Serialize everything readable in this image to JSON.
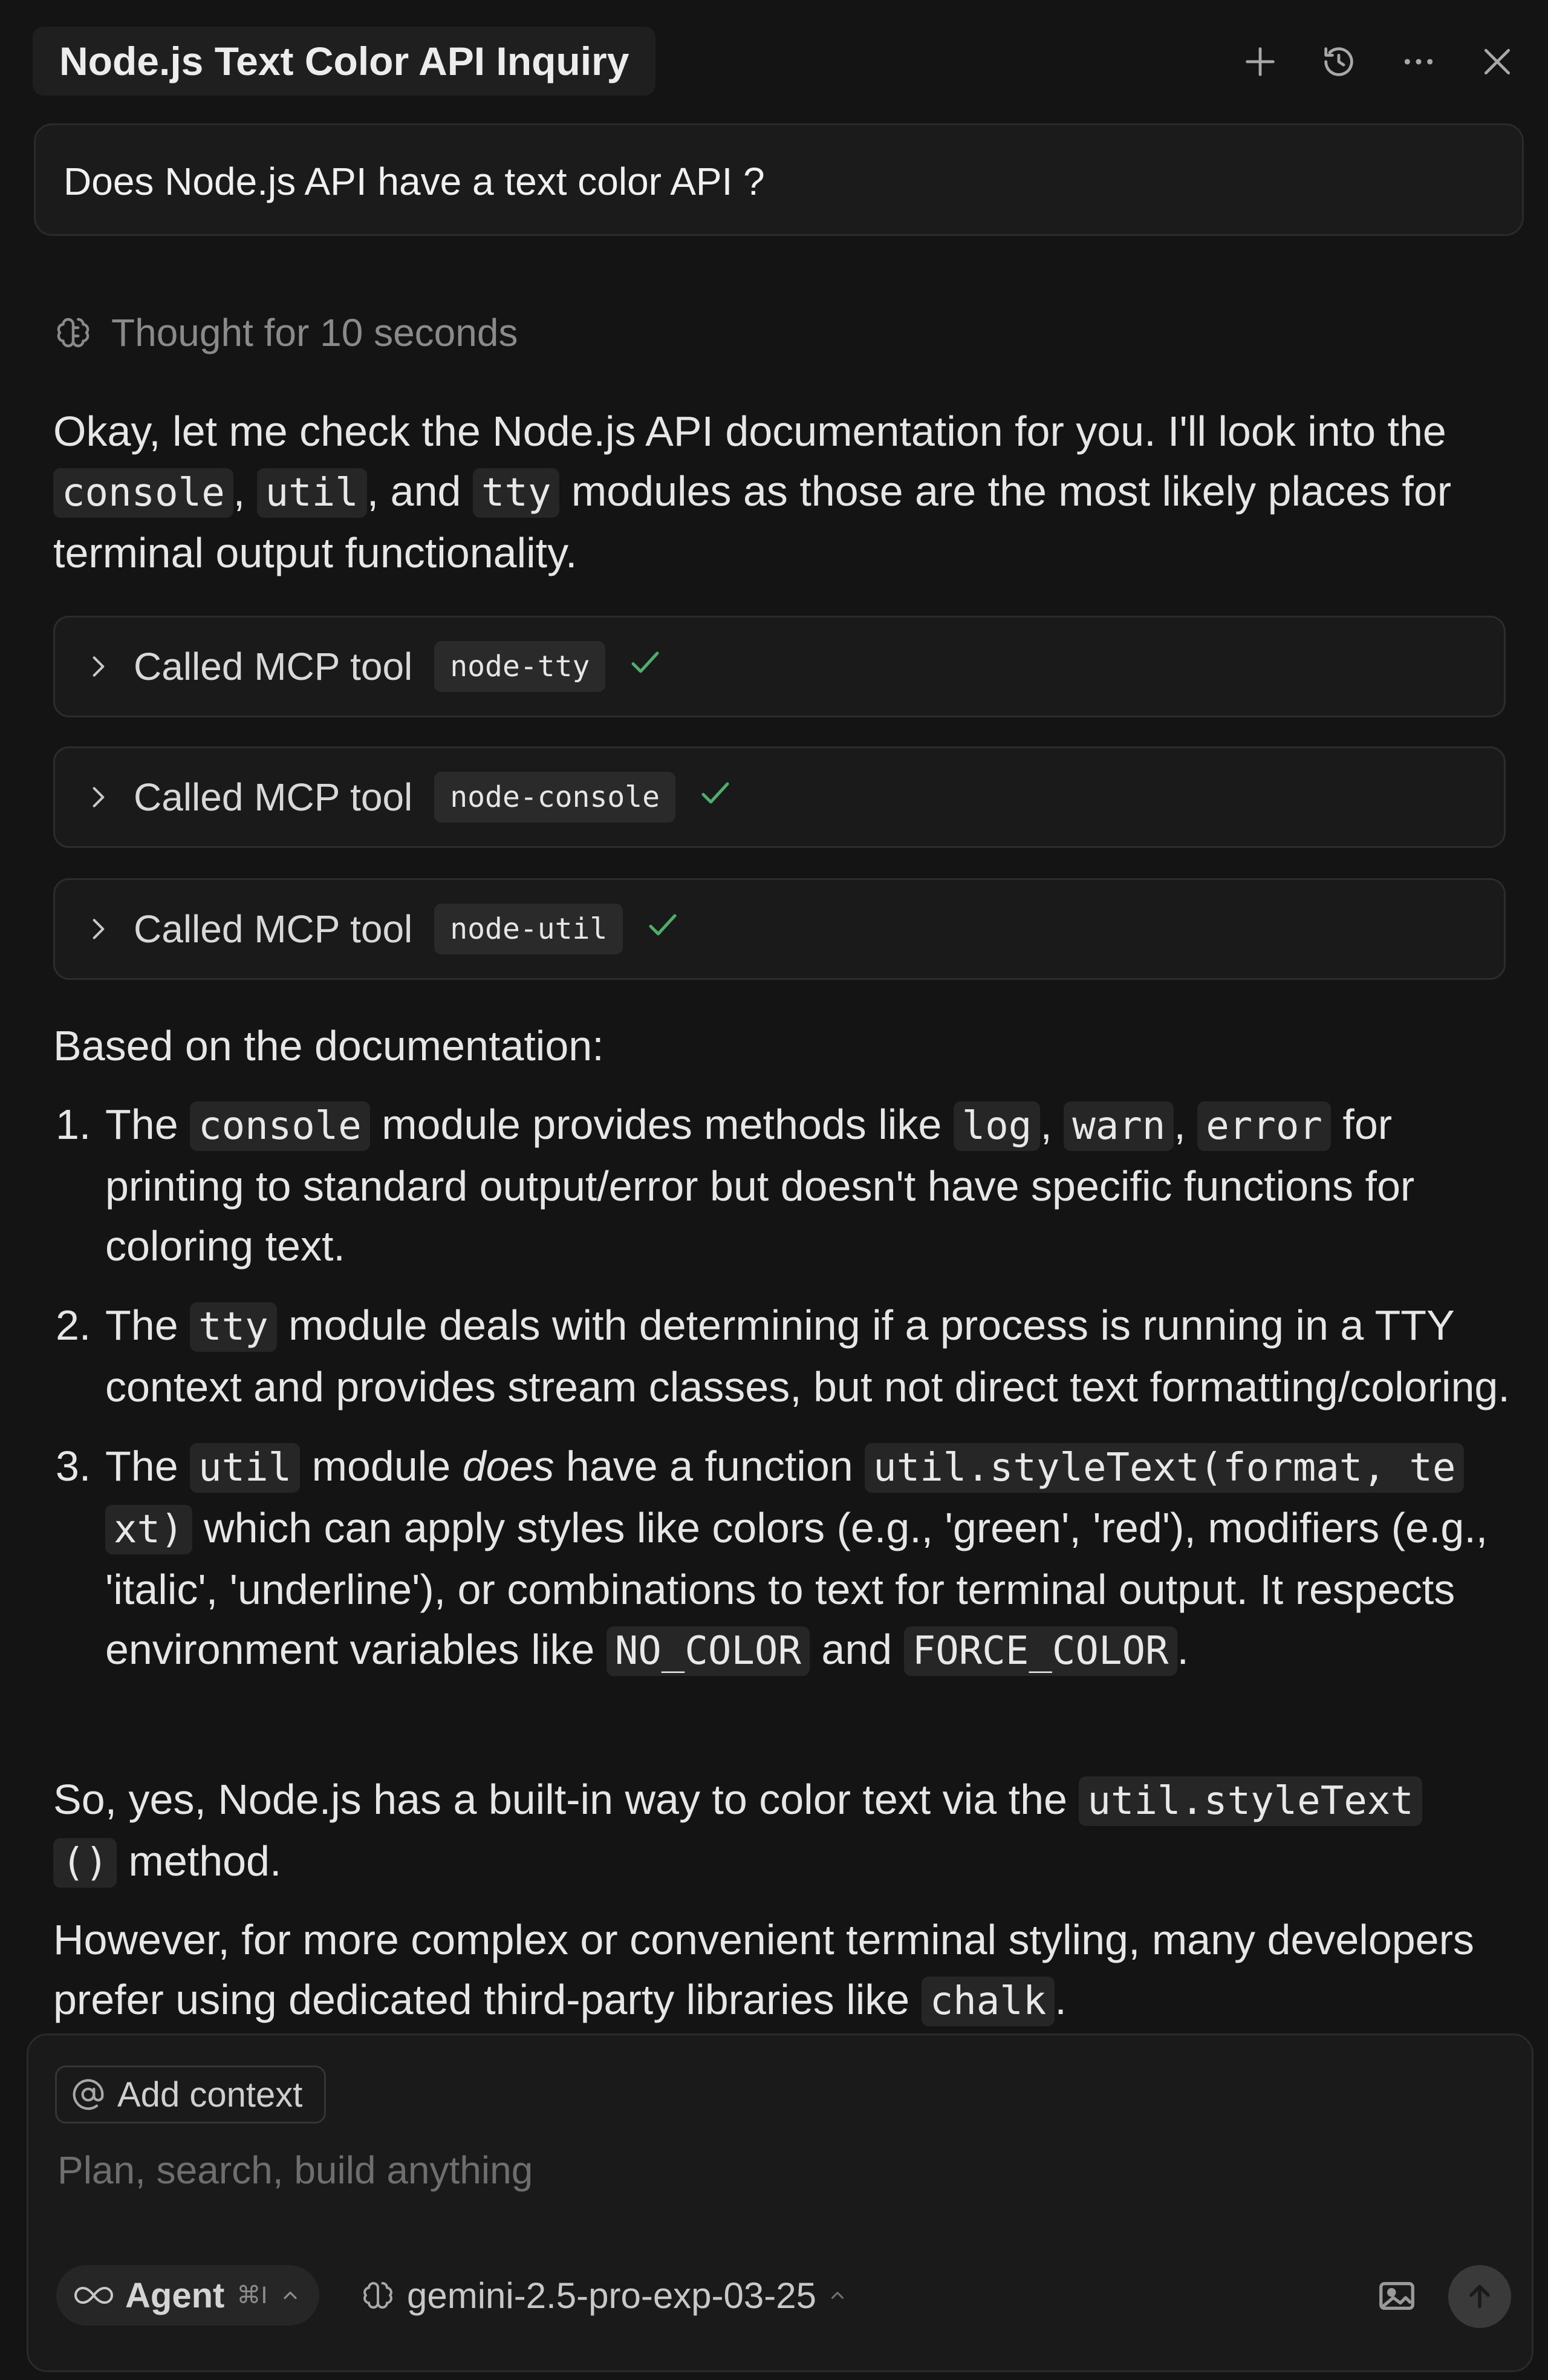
{
  "header": {
    "title": "Node.js Text Color API Inquiry",
    "icons": [
      "plus-icon",
      "history-icon",
      "more-icon",
      "close-icon"
    ]
  },
  "user_message": "Does Node.js API have a text color API ?",
  "thought": "Thought for 10 seconds",
  "intro": {
    "t1": "Okay, let me check the Node.js API documentation for you. I'll look into the ",
    "c1": "console",
    "t2": ", ",
    "c2": "util",
    "t3": ", and ",
    "c3": "tty",
    "t4": " modules as those are the most likely places for terminal output functionality."
  },
  "tool_calls": [
    {
      "label": "Called MCP tool",
      "tool": "node-tty"
    },
    {
      "label": "Called MCP tool",
      "tool": "node-console"
    },
    {
      "label": "Called MCP tool",
      "tool": "node-util"
    }
  ],
  "based_on": "Based on the documentation:",
  "list": {
    "item1": {
      "num": "1.",
      "t1": "The ",
      "c1": "console",
      "t2": " module provides methods like ",
      "c2": "log",
      "t3": ", ",
      "c3": "warn",
      "t4": ", ",
      "c4": "error",
      "t5": " for printing to standard output/error but doesn't have specific functions for coloring text."
    },
    "item2": {
      "num": "2.",
      "t1": "The ",
      "c1": "tty",
      "t2": " module deals with determining if a process is running in a TTY context and provides stream classes, but not direct text formatting/coloring."
    },
    "item3": {
      "num": "3.",
      "t1": "The ",
      "c1": "util",
      "t2": " module ",
      "em": "does",
      "t3": " have a function ",
      "c2a": "util.styleText(format, te",
      "c2b": "xt)",
      "t4": " which can apply styles like colors (e.g., 'green', 'red'), modifiers (e.g., 'italic', 'underline'), or combinations to text for terminal output. It respects environment variables like ",
      "c3": "NO_COLOR",
      "t5": " and ",
      "c4": "FORCE_COLOR",
      "t6": "."
    }
  },
  "so_yes": {
    "t1": "So, yes, Node.js has a built-in way to color text via the ",
    "c1a": "util.styleText",
    "c1b": "()",
    "t2": " method."
  },
  "however": {
    "t1": "However, for more complex or convenient terminal styling, many developers prefer using dedicated third-party libraries like ",
    "c1": "chalk",
    "t2": "."
  },
  "composer": {
    "add_context": "Add context",
    "placeholder": "Plan, search, build anything",
    "agent_label": "Agent",
    "agent_shortcut": "⌘I",
    "model": "gemini-2.5-pro-exp-03-25"
  },
  "colors": {
    "background": "#141414",
    "check": "#4caf6a",
    "code_bg": "#262626"
  }
}
